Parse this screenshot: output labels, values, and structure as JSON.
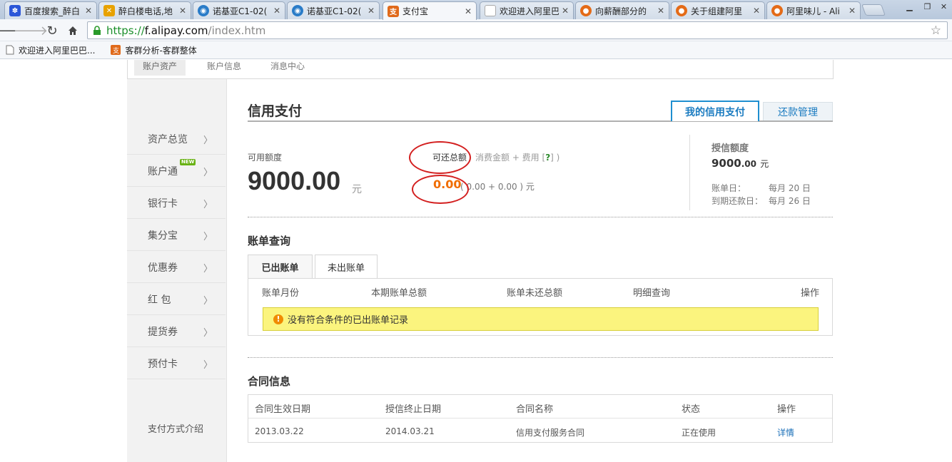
{
  "browser": {
    "tabs": [
      {
        "title": "百度搜索_醉白",
        "favicon": "baidu-paw-icon",
        "color": "#2b56d8"
      },
      {
        "title": "醉白楼电话,地",
        "favicon": "utensils-icon",
        "color": "#e8a200"
      },
      {
        "title": "诺基亚C1-02(",
        "favicon": "blue-globe-icon",
        "color": "#2a7cc8"
      },
      {
        "title": "诺基亚C1-02(",
        "favicon": "blue-globe-icon",
        "color": "#2a7cc8"
      },
      {
        "title": "支付宝",
        "favicon": "alipay-icon",
        "color": "#e06a1b",
        "active": true
      },
      {
        "title": "欢迎进入阿里巴",
        "favicon": "page-icon",
        "color": "#aaaaaa"
      },
      {
        "title": "向薪酬部分的",
        "favicon": "ali-orange-icon",
        "color": "#e46b18"
      },
      {
        "title": "关于组建阿里",
        "favicon": "ali-orange-icon",
        "color": "#e46b18"
      },
      {
        "title": "阿里味儿 - Ali",
        "favicon": "ali-orange-icon",
        "color": "#e46b18"
      }
    ],
    "url": {
      "scheme": "https://",
      "host": "f.alipay.com",
      "path": "/index.htm"
    },
    "bookmarks": [
      {
        "label": "欢迎进入阿里巴巴...",
        "icon": "page-icon"
      },
      {
        "label": "客群分析-客群整体",
        "icon": "alipay-icon"
      }
    ]
  },
  "topnav": {
    "items": [
      "账户资产",
      "账户信息",
      "消息中心"
    ]
  },
  "sidebar": {
    "items": [
      "资产总览",
      "账户通",
      "银行卡",
      "集分宝",
      "优惠券",
      "红 包",
      "提货券",
      "预付卡"
    ],
    "new_badge": "NEW",
    "footer_link": "支付方式介绍"
  },
  "main": {
    "title": "信用支付",
    "tabs": {
      "my_credit": "我的信用支付",
      "repay_mgmt": "还款管理"
    },
    "available": {
      "label": "可用额度",
      "amount": "9000.00",
      "unit": "元"
    },
    "repayable": {
      "label": "可还总额",
      "formula_pre": "消费金额 + 费用 [",
      "formula_q": "?",
      "formula_post": "]  )",
      "amount": "0.00",
      "detail": "( 0.00 + 0.00 ) 元"
    },
    "credit": {
      "label": "授信额度",
      "amount_int": "9000",
      "amount_dec": ".00",
      "unit": "元",
      "bill_day_label": "账单日：",
      "bill_day_value": "每月 20 日",
      "due_day_label": "到期还款日：",
      "due_day_value": "每月 26 日"
    },
    "bill_query": {
      "title": "账单查询",
      "tabs": [
        "已出账单",
        "未出账单"
      ],
      "headers": [
        "账单月份",
        "本期账单总额",
        "账单未还总额",
        "明细查询",
        "操作"
      ],
      "notice": "没有符合条件的已出账单记录"
    },
    "contract": {
      "title": "合同信息",
      "headers": [
        "合同生效日期",
        "授信终止日期",
        "合同名称",
        "状态",
        "操作"
      ],
      "rows": [
        {
          "start": "2013.03.22",
          "end": "2014.03.21",
          "name": "信用支付服务合同",
          "status": "正在使用",
          "action": "详情"
        }
      ]
    }
  },
  "colors": {
    "accent_blue": "#1f8fd0",
    "orange": "#f06d00",
    "annotation_red": "#d31f1f",
    "notice_yellow": "#fbf47e"
  }
}
